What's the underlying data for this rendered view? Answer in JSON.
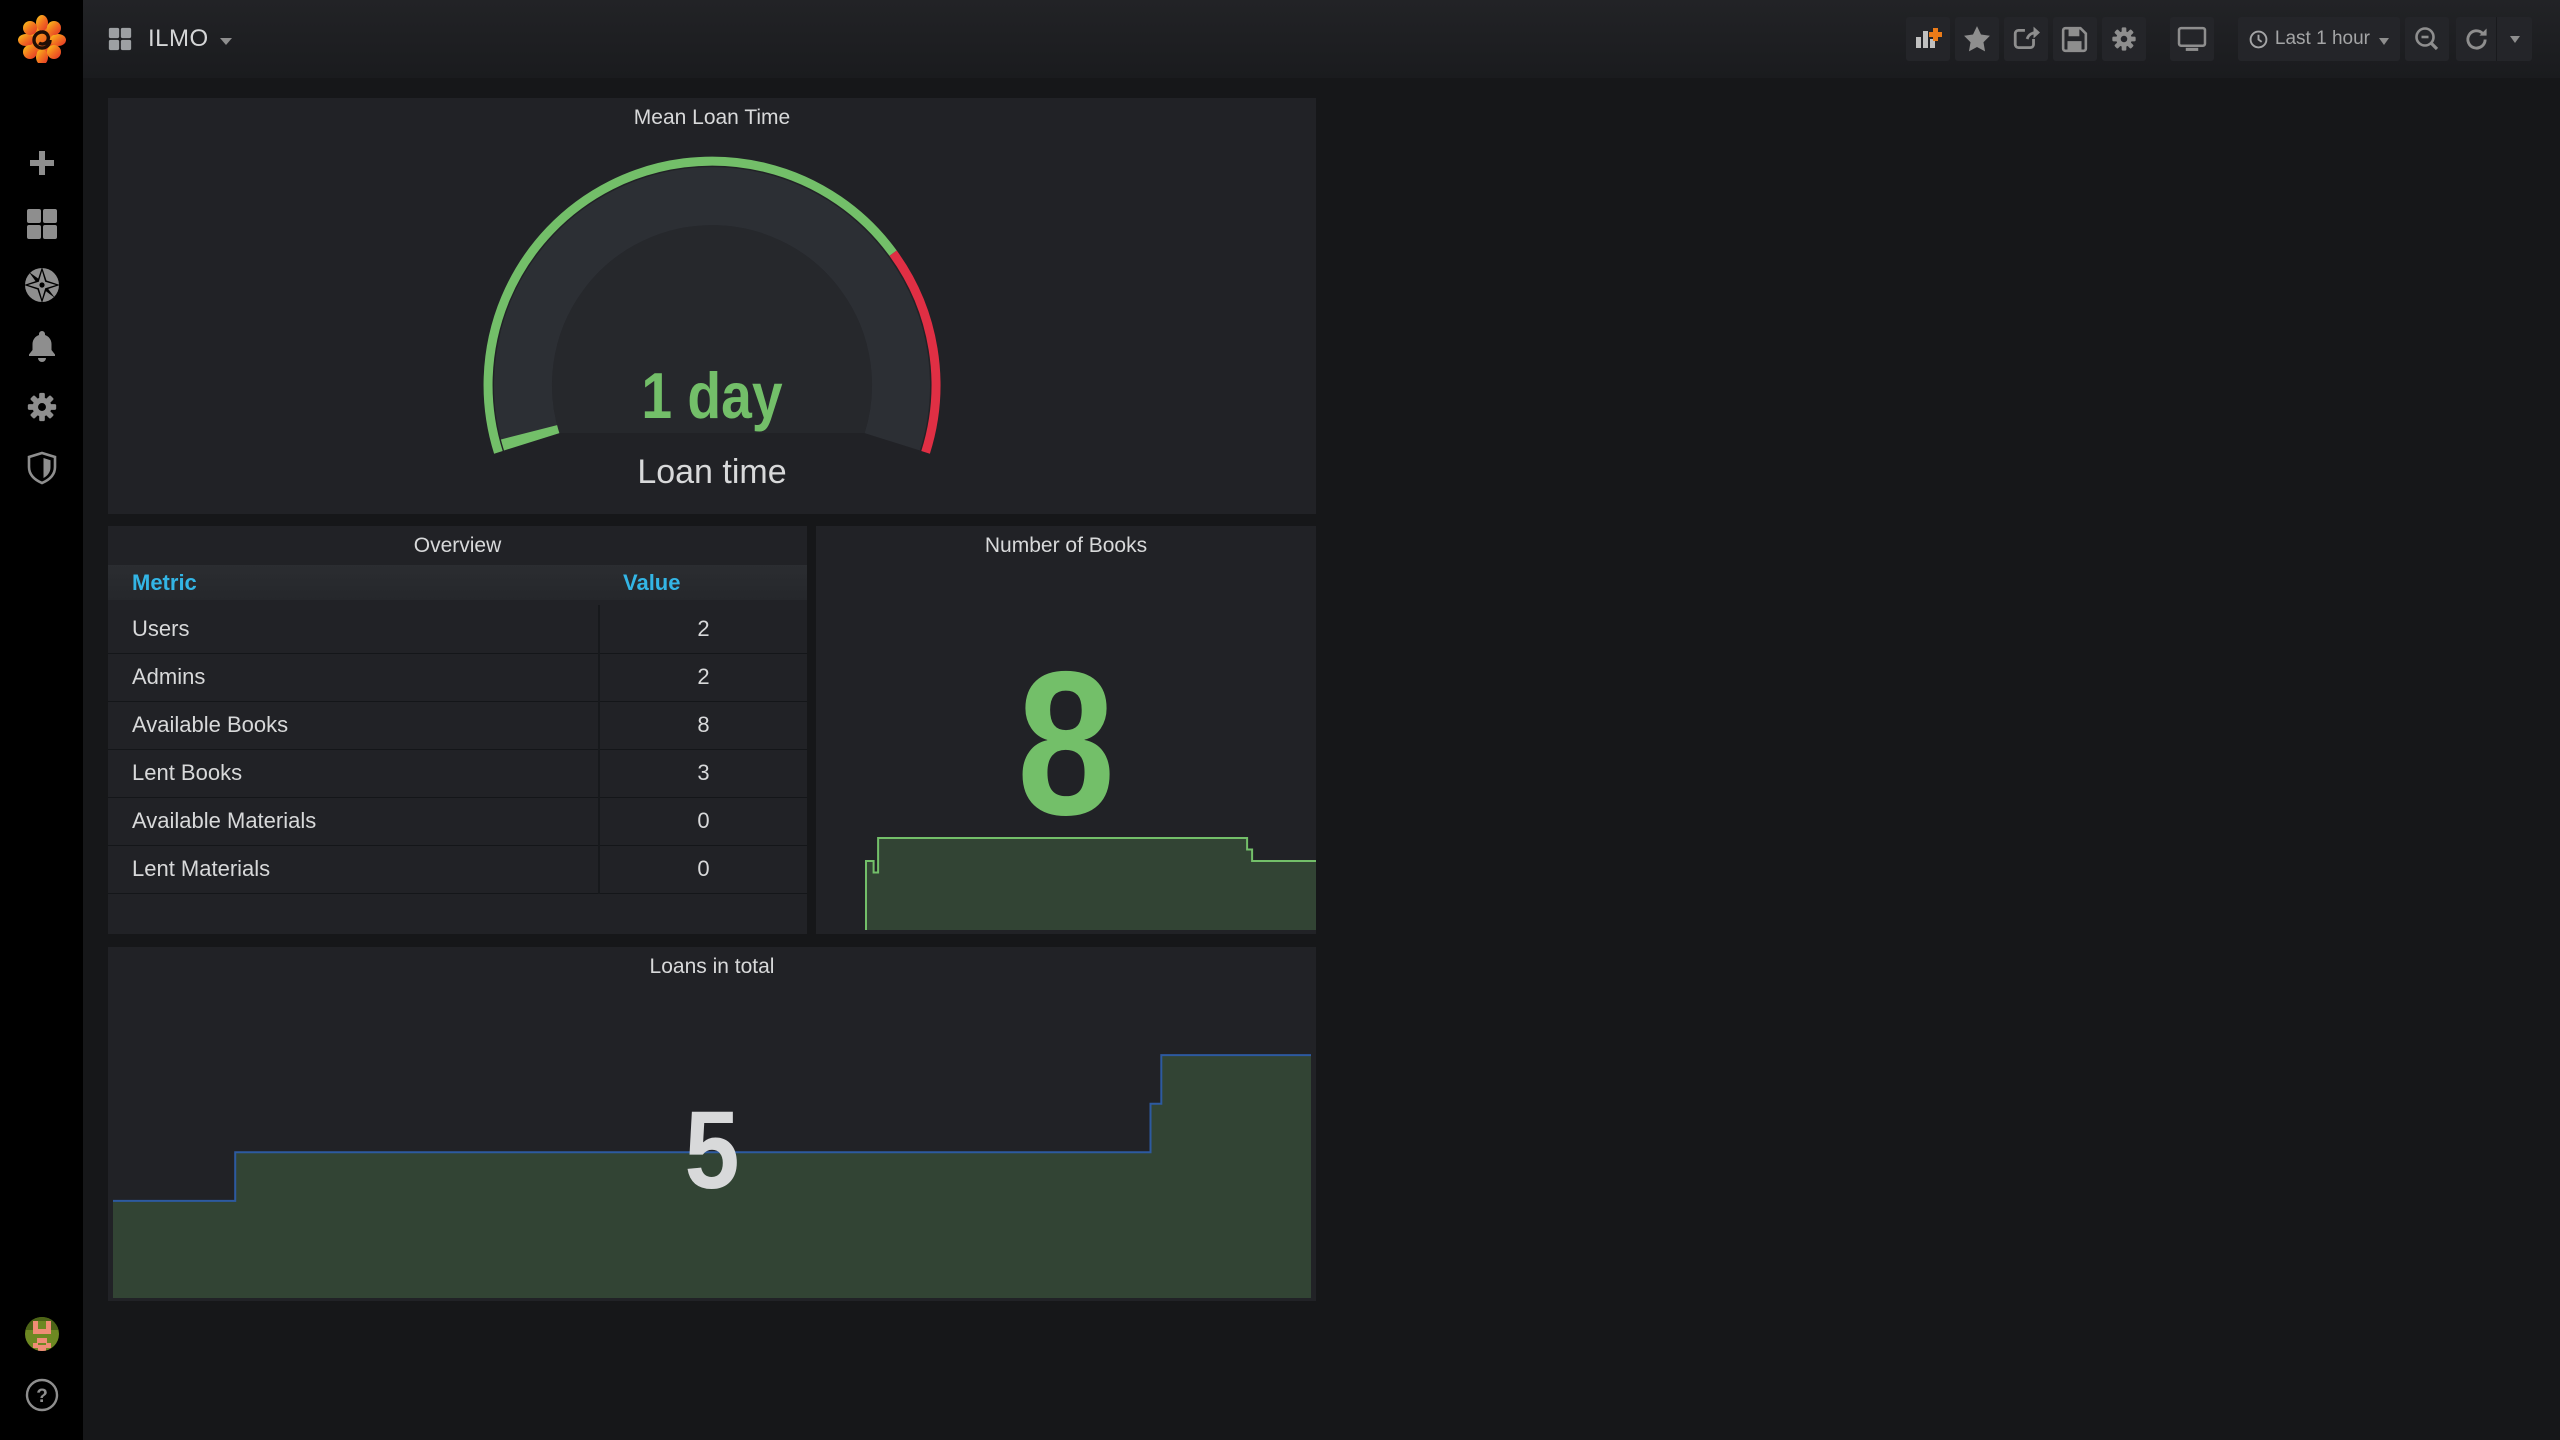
{
  "navbar": {
    "title": "ILMO",
    "time_range": "Last 1 hour",
    "accent_orange": "#eb7b18"
  },
  "sidebar": {
    "icons": [
      "plus",
      "dashboards",
      "explore",
      "alerting",
      "configuration",
      "security"
    ],
    "help": "?"
  },
  "chart_data": [
    {
      "id": "gauge",
      "type": "gauge",
      "title": "Mean Loan Time",
      "value": 1,
      "display": "1 day",
      "label": "Loan time",
      "min": 0,
      "threshold_fraction": 0.751,
      "color_value": "#73BF69",
      "color_ok": "#73BF69",
      "color_alert": "#E02F44",
      "color_back": "#2c2f34",
      "color_face": "#26282c"
    },
    {
      "id": "overview",
      "type": "table",
      "title": "Overview",
      "columns": [
        "Metric",
        "Value"
      ],
      "rows": [
        [
          "Users",
          "2"
        ],
        [
          "Admins",
          "2"
        ],
        [
          "Available Books",
          "8"
        ],
        [
          "Lent Books",
          "3"
        ],
        [
          "Available Materials",
          "0"
        ],
        [
          "Lent Materials",
          "0"
        ]
      ]
    },
    {
      "id": "books",
      "type": "area",
      "title": "Number of Books",
      "big_value": "8",
      "ylim": [
        0,
        8
      ],
      "line_color": "#73BF69",
      "fill_color": "rgba(115,191,105,0.22)",
      "points": [
        [
          0,
          0
        ],
        [
          0,
          6
        ],
        [
          0.017,
          6
        ],
        [
          0.017,
          5
        ],
        [
          0.027,
          5
        ],
        [
          0.027,
          8
        ],
        [
          0.847,
          8
        ],
        [
          0.847,
          7
        ],
        [
          0.858,
          7
        ],
        [
          0.858,
          6
        ],
        [
          1,
          6
        ]
      ]
    },
    {
      "id": "loans",
      "type": "area",
      "title": "Loans in total",
      "big_value": "5",
      "ylim": [
        2,
        8.3
      ],
      "line_color": "#2d5aa0",
      "fill_color": "rgba(115,191,105,0.22)",
      "points": [
        [
          0,
          4
        ],
        [
          0.102,
          4
        ],
        [
          0.102,
          5
        ],
        [
          0.866,
          5
        ],
        [
          0.866,
          6
        ],
        [
          0.875,
          6
        ],
        [
          0.875,
          7
        ],
        [
          1,
          7
        ]
      ]
    }
  ]
}
